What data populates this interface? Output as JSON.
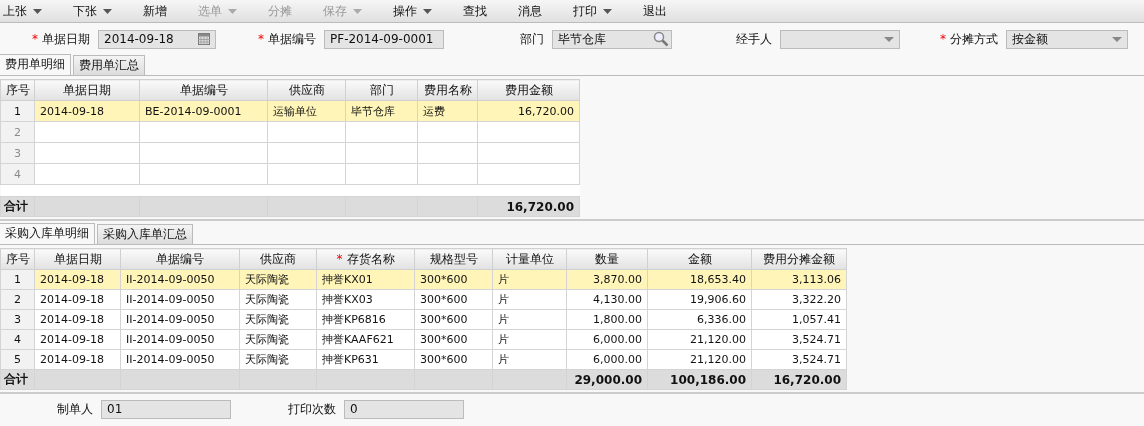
{
  "toolbar": [
    {
      "label": "上张",
      "dropdown": true,
      "disabled": false
    },
    {
      "label": "下张",
      "dropdown": true,
      "disabled": false
    },
    {
      "label": "新增",
      "dropdown": false,
      "disabled": false
    },
    {
      "label": "选单",
      "dropdown": true,
      "disabled": true
    },
    {
      "label": "分摊",
      "dropdown": false,
      "disabled": true
    },
    {
      "label": "保存",
      "dropdown": true,
      "disabled": true
    },
    {
      "label": "操作",
      "dropdown": true,
      "disabled": false
    },
    {
      "label": "查找",
      "dropdown": false,
      "disabled": false
    },
    {
      "label": "消息",
      "dropdown": false,
      "disabled": false
    },
    {
      "label": "打印",
      "dropdown": true,
      "disabled": false
    },
    {
      "label": "退出",
      "dropdown": false,
      "disabled": false
    }
  ],
  "header_fields": [
    {
      "required_mark": "*",
      "label": "单据日期",
      "kind": "date",
      "value": "2014-09-18"
    },
    {
      "required_mark": "*",
      "label": "单据编号",
      "kind": "text",
      "value": "PF-2014-09-0001"
    },
    {
      "label": "部门",
      "kind": "search",
      "value": "毕节仓库"
    },
    {
      "label": "经手人",
      "kind": "select"
    },
    {
      "required_mark": "*",
      "label": "分摊方式",
      "kind": "select",
      "value": "按金额"
    }
  ],
  "expense_tabs": [
    {
      "label": "费用单明细",
      "selected": true
    },
    {
      "label": "费用单汇总",
      "selected": false
    }
  ],
  "expense_table": {
    "columns": [
      {
        "label": "序号",
        "kind": "index"
      },
      {
        "label": "单据日期",
        "kind": "text"
      },
      {
        "label": "单据编号",
        "kind": "text"
      },
      {
        "label": "供应商",
        "kind": "text"
      },
      {
        "label": "部门",
        "kind": "text"
      },
      {
        "label": "费用名称",
        "kind": "text"
      },
      {
        "label": "费用金额",
        "kind": "number",
        "total": "16,720.00"
      }
    ],
    "rows": [
      {
        "selected": true,
        "disabled": false,
        "cells": [
          "1",
          "2014-09-18",
          "BE-2014-09-0001",
          "运输单位",
          "毕节仓库",
          "运费",
          "16,720.00"
        ]
      },
      {
        "selected": false,
        "disabled": true,
        "cells": [
          "2"
        ]
      },
      {
        "selected": false,
        "disabled": true,
        "cells": [
          "3"
        ]
      },
      {
        "selected": false,
        "disabled": true,
        "cells": [
          "4"
        ]
      }
    ],
    "total_label": "合计"
  },
  "purchase_tabs": [
    {
      "label": "采购入库单明细",
      "selected": true
    },
    {
      "label": "采购入库单汇总",
      "selected": false
    }
  ],
  "purchase_table": {
    "columns": [
      {
        "label": "序号",
        "kind": "index"
      },
      {
        "label": "单据日期",
        "kind": "text"
      },
      {
        "label": "单据编号",
        "kind": "text"
      },
      {
        "label": "供应商",
        "kind": "text"
      },
      {
        "required_mark": "*",
        "label": "存货名称",
        "kind": "text"
      },
      {
        "label": "规格型号",
        "kind": "text"
      },
      {
        "label": "计量单位",
        "kind": "text"
      },
      {
        "label": "数量",
        "kind": "number",
        "total": "29,000.00"
      },
      {
        "label": "金额",
        "kind": "number",
        "total": "100,186.00"
      },
      {
        "label": "费用分摊金额",
        "kind": "number",
        "total": "16,720.00"
      }
    ],
    "rows": [
      {
        "selected": true,
        "cells": [
          "1",
          "2014-09-18",
          "II-2014-09-0050",
          "天际陶瓷",
          "抻誉KX01",
          "300*600",
          "片",
          "3,870.00",
          "18,653.40",
          "3,113.06"
        ]
      },
      {
        "selected": false,
        "cells": [
          "2",
          "2014-09-18",
          "II-2014-09-0050",
          "天际陶瓷",
          "抻誉KX03",
          "300*600",
          "片",
          "4,130.00",
          "19,906.60",
          "3,322.20"
        ]
      },
      {
        "selected": false,
        "cells": [
          "3",
          "2014-09-18",
          "II-2014-09-0050",
          "天际陶瓷",
          "抻誉KP6816",
          "300*600",
          "片",
          "1,800.00",
          "6,336.00",
          "1,057.41"
        ]
      },
      {
        "selected": false,
        "cells": [
          "4",
          "2014-09-18",
          "II-2014-09-0050",
          "天际陶瓷",
          "抻誉KAAF621",
          "300*600",
          "片",
          "6,000.00",
          "21,120.00",
          "3,524.71"
        ]
      },
      {
        "selected": false,
        "cells": [
          "5",
          "2014-09-18",
          "II-2014-09-0050",
          "天际陶瓷",
          "抻誉KP631",
          "300*600",
          "片",
          "6,000.00",
          "21,120.00",
          "3,524.71"
        ]
      }
    ],
    "total_label": "合计"
  },
  "footer_fields": [
    {
      "label": "制单人",
      "value": "01"
    },
    {
      "label": "打印次数",
      "value": "0"
    }
  ]
}
